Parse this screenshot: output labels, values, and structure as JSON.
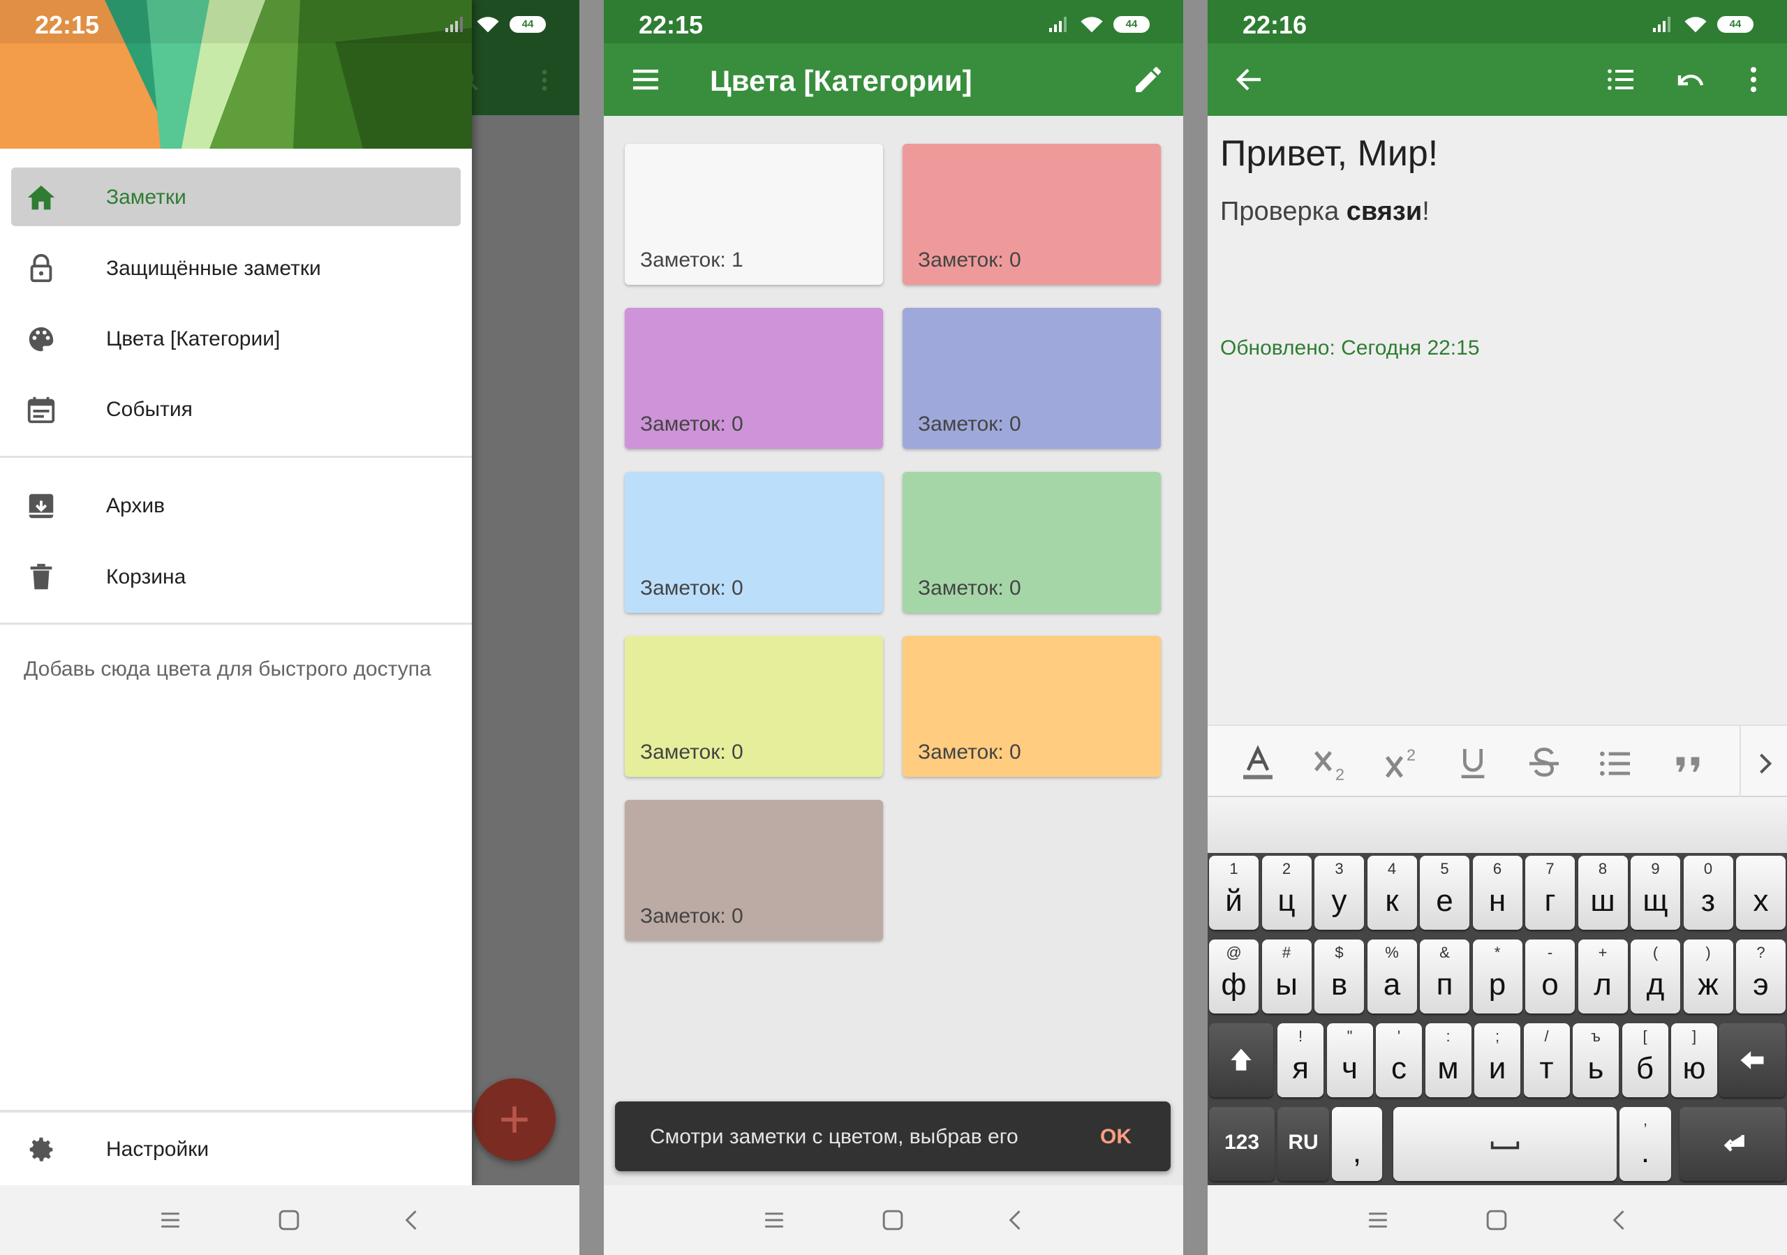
{
  "status": {
    "screen1_time": "22:15",
    "screen2_time": "22:15",
    "screen3_time": "22:16",
    "battery": "44"
  },
  "drawer": {
    "items": [
      {
        "label": "Заметки",
        "icon": "home-icon",
        "active": true
      },
      {
        "label": "Защищённые заметки",
        "icon": "lock-icon"
      },
      {
        "label": "Цвета [Категории]",
        "icon": "palette-icon"
      },
      {
        "label": "События",
        "icon": "calendar-icon"
      },
      {
        "label": "Архив",
        "icon": "archive-icon"
      },
      {
        "label": "Корзина",
        "icon": "trash-icon"
      }
    ],
    "hint": "Добавь сюда цвета для быстрого доступа",
    "settings_label": "Настройки"
  },
  "colors_screen": {
    "title": "Цвета [Категории]",
    "tiles": [
      {
        "color": "#f7f7f7",
        "count": "Заметок: 1"
      },
      {
        "color": "#ef9a9a",
        "count": "Заметок: 0"
      },
      {
        "color": "#ce93d8",
        "count": "Заметок: 0"
      },
      {
        "color": "#9fa8da",
        "count": "Заметок: 0"
      },
      {
        "color": "#bbdefb",
        "count": "Заметок: 0"
      },
      {
        "color": "#a5d6a7",
        "count": "Заметок: 0"
      },
      {
        "color": "#e6ee9c",
        "count": "Заметок: 0"
      },
      {
        "color": "#ffcc80",
        "count": "Заметок: 0"
      },
      {
        "color": "#bcaaa4",
        "count": "Заметок: 0"
      }
    ],
    "snackbar_message": "Смотри заметки с цветом, выбрав его",
    "snackbar_action": "OK"
  },
  "editor": {
    "title": "Привет, Мир!",
    "body_prefix": "Проверка ",
    "body_bold": "связи",
    "body_suffix": "!",
    "updated": "Обновлено: Сегодня 22:15",
    "format_tools": [
      "text-color-icon",
      "subscript-icon",
      "superscript-icon",
      "underline-icon",
      "strikethrough-icon",
      "bullet-list-icon",
      "quote-icon",
      "chevron-right-icon"
    ]
  },
  "keyboard": {
    "row1": [
      [
        "1",
        "й"
      ],
      [
        "2",
        "ц"
      ],
      [
        "3",
        "у"
      ],
      [
        "4",
        "к"
      ],
      [
        "5",
        "е"
      ],
      [
        "6",
        "н"
      ],
      [
        "7",
        "г"
      ],
      [
        "8",
        "ш"
      ],
      [
        "9",
        "щ"
      ],
      [
        "0",
        "з"
      ],
      [
        "",
        "х"
      ]
    ],
    "row2": [
      [
        "@",
        "ф"
      ],
      [
        "#",
        "ы"
      ],
      [
        "$",
        "в"
      ],
      [
        "%",
        "а"
      ],
      [
        "&",
        "п"
      ],
      [
        "*",
        "р"
      ],
      [
        "-",
        "о"
      ],
      [
        "+",
        "л"
      ],
      [
        "(",
        "д"
      ],
      [
        ")",
        "ж"
      ],
      [
        "?",
        "э"
      ]
    ],
    "row3": [
      [
        "!",
        "я"
      ],
      [
        "\"",
        "ч"
      ],
      [
        "'",
        "с"
      ],
      [
        ":",
        "м"
      ],
      [
        ";",
        "и"
      ],
      [
        "/",
        "т"
      ],
      [
        "ъ",
        "ь"
      ],
      [
        "[",
        "б"
      ],
      [
        "]",
        "ю"
      ]
    ],
    "mode_label": "123",
    "lang_label": "RU",
    "comma": ",",
    "period_hint": ",",
    "period": "."
  },
  "colors": {
    "primary": "#388e3c",
    "primary_dark": "#2e7d32",
    "accent": "#ff9e80"
  }
}
